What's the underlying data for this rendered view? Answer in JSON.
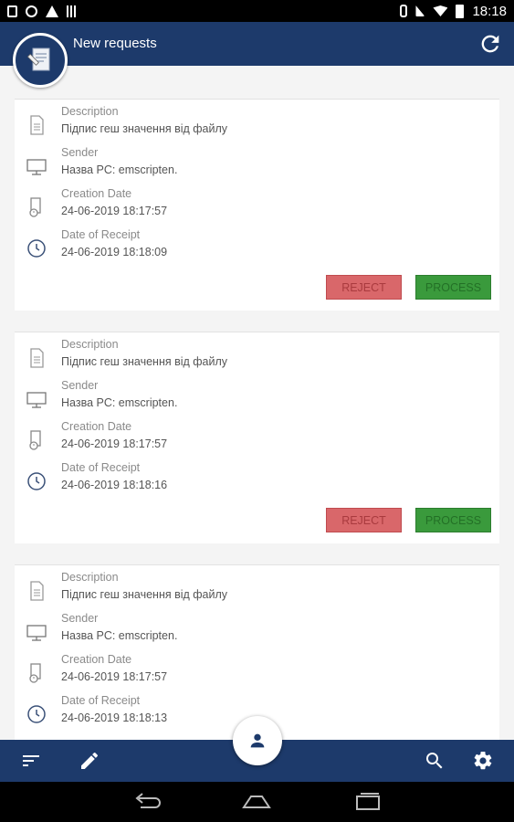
{
  "status_bar": {
    "time": "18:18"
  },
  "header": {
    "title": "New requests",
    "refresh_icon": "refresh-icon",
    "logo_icon": "document-sign-icon"
  },
  "labels": {
    "description": "Description",
    "sender": "Sender",
    "creation_date": "Creation Date",
    "date_of_receipt": "Date of Receipt"
  },
  "requests": [
    {
      "description": "Підпис геш значення від файлу",
      "sender": "Назва PC: emscripten.",
      "creation_date": "24-06-2019 18:17:57",
      "date_of_receipt": "24-06-2019 18:18:09",
      "reject_label": "REJECT",
      "process_label": "PROCESS"
    },
    {
      "description": "Підпис геш значення від файлу",
      "sender": "Назва PC: emscripten.",
      "creation_date": "24-06-2019 18:17:57",
      "date_of_receipt": "24-06-2019 18:18:16",
      "reject_label": "REJECT",
      "process_label": "PROCESS"
    },
    {
      "description": "Підпис геш значення від файлу",
      "sender": "Назва PC: emscripten.",
      "creation_date": "24-06-2019 18:17:57",
      "date_of_receipt": "24-06-2019 18:18:13"
    }
  ],
  "bottom_bar": {
    "icons": [
      "sort-icon",
      "edit-icon",
      "user-icon",
      "search-icon",
      "settings-icon"
    ]
  },
  "colors": {
    "primary": "#1d3a6b",
    "reject": "#d9676a",
    "process": "#3a9a3c"
  }
}
